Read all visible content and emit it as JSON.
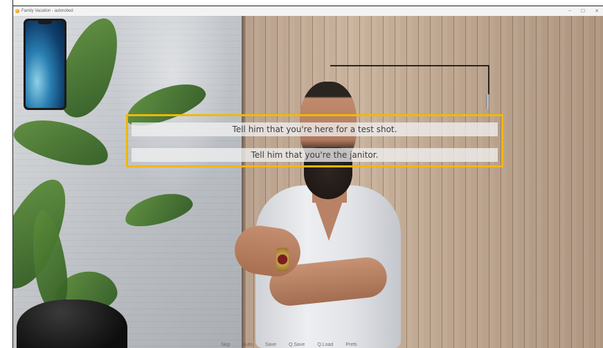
{
  "window": {
    "title": "Family Vacation - autorobed",
    "controls": [
      "–",
      "☐",
      "✕"
    ]
  },
  "phone": {
    "icon": "phone-icon"
  },
  "choices": [
    "Tell him that you're here for a test shot.",
    "Tell him that you're the janitor."
  ],
  "highlight_color": "#f2b705",
  "quick_menu": [
    "Skip",
    "Auto",
    "Save",
    "Q.Save",
    "Q.Load",
    "Prefs"
  ]
}
